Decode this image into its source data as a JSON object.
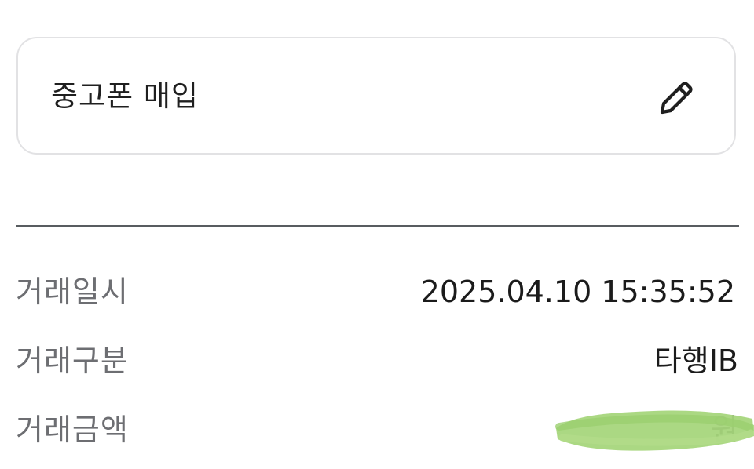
{
  "memo": {
    "title": "중고폰 매입",
    "edit_icon": "pencil-icon"
  },
  "details": {
    "datetime": {
      "label": "거래일시",
      "value": "2025.04.10 15:35:52"
    },
    "type": {
      "label": "거래구분",
      "value": "타행IB"
    },
    "amount": {
      "label": "거래금액",
      "value_visible_fragment": "원",
      "redaction_color": "#a6d67c"
    }
  },
  "colors": {
    "card_border": "#e2e2e4",
    "divider": "#585c60",
    "label_text": "#6d6e72",
    "value_text": "#1b1b1b"
  }
}
